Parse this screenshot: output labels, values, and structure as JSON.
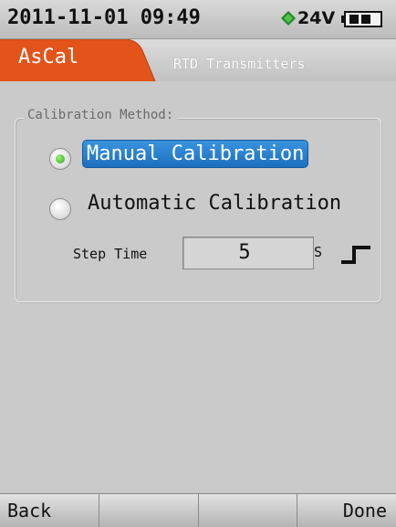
{
  "status_bar": {
    "datetime": "2011-11-01 09:49",
    "voltage": "24V",
    "icons": [
      "supply-diamond-icon",
      "battery-icon"
    ]
  },
  "header": {
    "active_tab": "AsCal",
    "subtitle": "RTD Transmitters"
  },
  "calibration": {
    "group_label": "Calibration Method:",
    "options": [
      {
        "label": "Manual Calibration",
        "selected": true
      },
      {
        "label": "Automatic Calibration",
        "selected": false
      }
    ],
    "step_time_label": "Step Time",
    "step_time_value": "5",
    "step_time_unit": "S"
  },
  "softkeys": {
    "back": "Back",
    "key2": "",
    "key3": "",
    "done": "Done"
  },
  "colors": {
    "tab_orange": "#e2541a",
    "selection_blue": "#2a82d2",
    "radio_green": "#3cc024"
  }
}
